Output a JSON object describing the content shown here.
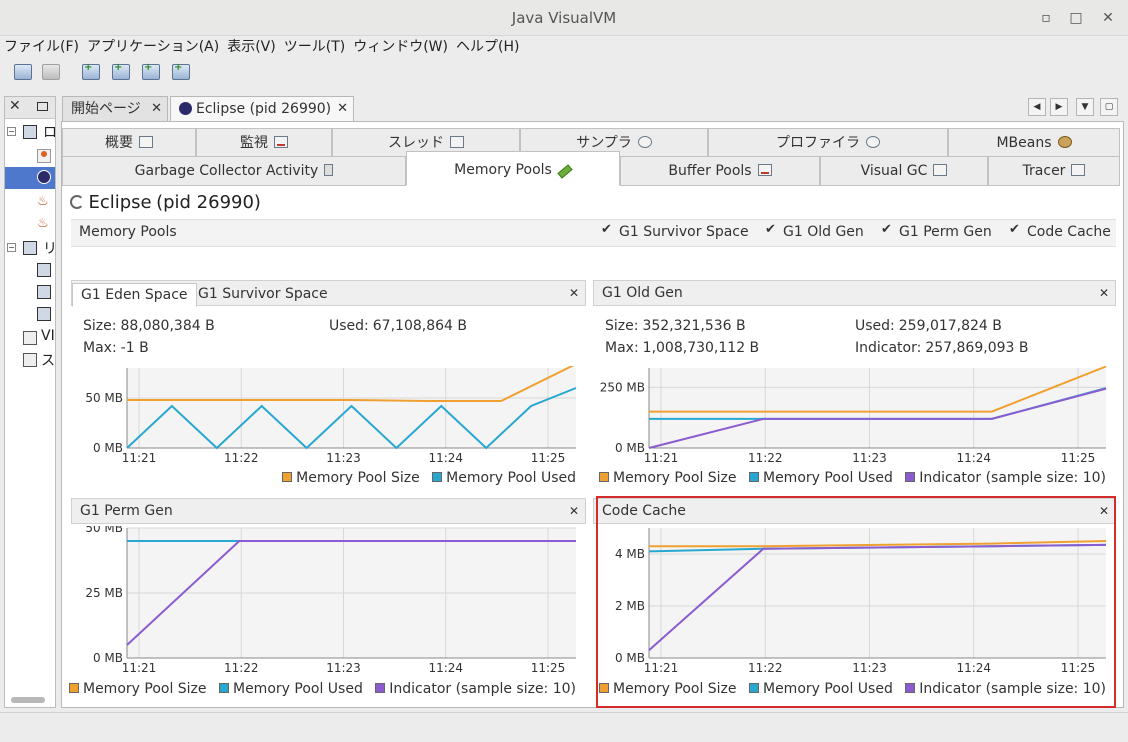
{
  "window": {
    "title": "Java VisualVM",
    "minimize": "▫",
    "maximize": "□",
    "close": "✕"
  },
  "menu": [
    "ファイル(F)",
    "アプリケーション(A)",
    "表示(V)",
    "ツール(T)",
    "ウィンドウ(W)",
    "ヘルプ(H)"
  ],
  "toolbar_icons": [
    "load-application-icon",
    "save-icon",
    "add-jmx-connection-icon",
    "add-remote-host-icon",
    "add-core-dump-icon",
    "add-snapshot-icon"
  ],
  "left_panel": {
    "rows": [
      {
        "label": "ロ",
        "type": "local"
      },
      {
        "label": "",
        "type": "app"
      },
      {
        "label": "",
        "type": "eclipse"
      },
      {
        "label": "",
        "type": "java"
      },
      {
        "label": "",
        "type": "java"
      },
      {
        "label": "リ",
        "type": "remote"
      },
      {
        "label": "",
        "type": "host"
      },
      {
        "label": "",
        "type": "host"
      },
      {
        "label": "",
        "type": "host"
      },
      {
        "label": "VI",
        "type": "vm-core"
      },
      {
        "label": "ス",
        "type": "snapshots"
      }
    ]
  },
  "doc_tabs": [
    {
      "label": "開始ページ",
      "active": false
    },
    {
      "label": "Eclipse (pid 26990)",
      "active": true
    }
  ],
  "top_tabs": [
    "概要",
    "監視",
    "スレッド",
    "サンプラ",
    "プロファイラ",
    "MBeans"
  ],
  "sub_tabs": [
    "Garbage Collector Activity",
    "Memory Pools",
    "Buffer Pools",
    "Visual GC",
    "Tracer"
  ],
  "active_sub_tab": "Memory Pools",
  "process": {
    "name": "Eclipse",
    "pid": "(pid 26990)"
  },
  "memory_pools_bar": {
    "label": "Memory Pools",
    "checkboxes": [
      "G1 Survivor Space",
      "G1 Old Gen",
      "G1 Perm Gen",
      "Code Cache"
    ]
  },
  "panels": {
    "eden": {
      "tabs": [
        "G1 Eden Space",
        "G1 Survivor Space"
      ],
      "size_label": "Size:",
      "size": "88,080,384 B",
      "used_label": "Used:",
      "used": "67,108,864 B",
      "max_label": "Max:",
      "max": "-1 B",
      "legend": [
        "Memory Pool Size",
        "Memory Pool Used"
      ]
    },
    "oldgen": {
      "title": "G1 Old Gen",
      "size_label": "Size:",
      "size": "352,321,536 B",
      "used_label": "Used:",
      "used": "259,017,824 B",
      "max_label": "Max:",
      "max": "1,008,730,112 B",
      "ind_label": "Indicator:",
      "indicator": "257,869,093 B",
      "legend": [
        "Memory Pool Size",
        "Memory Pool Used",
        "Indicator (sample size: 10)"
      ]
    },
    "permgen": {
      "title": "G1 Perm Gen",
      "legend": [
        "Memory Pool Size",
        "Memory Pool Used",
        "Indicator (sample size: 10)"
      ]
    },
    "codecache": {
      "title": "Code Cache",
      "legend": [
        "Memory Pool Size",
        "Memory Pool Used",
        "Indicator (sample size: 10)"
      ]
    }
  },
  "colors": {
    "size": "#f0a030",
    "used": "#28a8d0",
    "indicator": "#8a5cd0",
    "highlight": "#d42b2b"
  },
  "chart_data": [
    {
      "type": "line",
      "id": "eden",
      "x": [
        "11:21",
        "11:22",
        "11:23",
        "11:24",
        "11:25"
      ],
      "yticks": [
        "0 MB",
        "50 MB"
      ],
      "ylim": [
        0,
        80
      ],
      "series": [
        {
          "name": "Memory Pool Size",
          "values": [
            48,
            48,
            48,
            48,
            47,
            47,
            84
          ]
        },
        {
          "name": "Memory Pool Used",
          "values": [
            0,
            42,
            0,
            42,
            0,
            42,
            0,
            42,
            0,
            42,
            60
          ]
        }
      ]
    },
    {
      "type": "line",
      "id": "oldgen",
      "x": [
        "11:21",
        "11:22",
        "11:23",
        "11:24",
        "11:25"
      ],
      "yticks": [
        "0 MB",
        "250 MB"
      ],
      "ylim": [
        0,
        330
      ],
      "series": [
        {
          "name": "Memory Pool Size",
          "values": [
            150,
            150,
            150,
            150,
            336
          ]
        },
        {
          "name": "Memory Pool Used",
          "values": [
            120,
            120,
            120,
            120,
            247
          ]
        },
        {
          "name": "Indicator (sample size: 10)",
          "values": [
            0,
            120,
            120,
            120,
            245
          ]
        }
      ]
    },
    {
      "type": "line",
      "id": "permgen",
      "x": [
        "11:21",
        "11:22",
        "11:23",
        "11:24",
        "11:25"
      ],
      "yticks": [
        "0 MB",
        "25 MB",
        "50 MB"
      ],
      "ylim": [
        0,
        50
      ],
      "series": [
        {
          "name": "Memory Pool Size",
          "values": [
            45,
            45,
            45,
            45,
            45
          ]
        },
        {
          "name": "Memory Pool Used",
          "values": [
            45,
            45,
            45,
            45,
            45
          ]
        },
        {
          "name": "Indicator (sample size: 10)",
          "values": [
            5,
            45,
            45,
            45,
            45
          ]
        }
      ]
    },
    {
      "type": "line",
      "id": "codecache",
      "x": [
        "11:21",
        "11:22",
        "11:23",
        "11:24",
        "11:25"
      ],
      "yticks": [
        "0 MB",
        "2 MB",
        "4 MB"
      ],
      "ylim": [
        0,
        5
      ],
      "series": [
        {
          "name": "Memory Pool Size",
          "values": [
            4.3,
            4.3,
            4.35,
            4.4,
            4.5
          ]
        },
        {
          "name": "Memory Pool Used",
          "values": [
            4.1,
            4.2,
            4.25,
            4.3,
            4.35
          ]
        },
        {
          "name": "Indicator (sample size: 10)",
          "values": [
            0.3,
            4.2,
            4.25,
            4.3,
            4.35
          ]
        }
      ]
    }
  ]
}
